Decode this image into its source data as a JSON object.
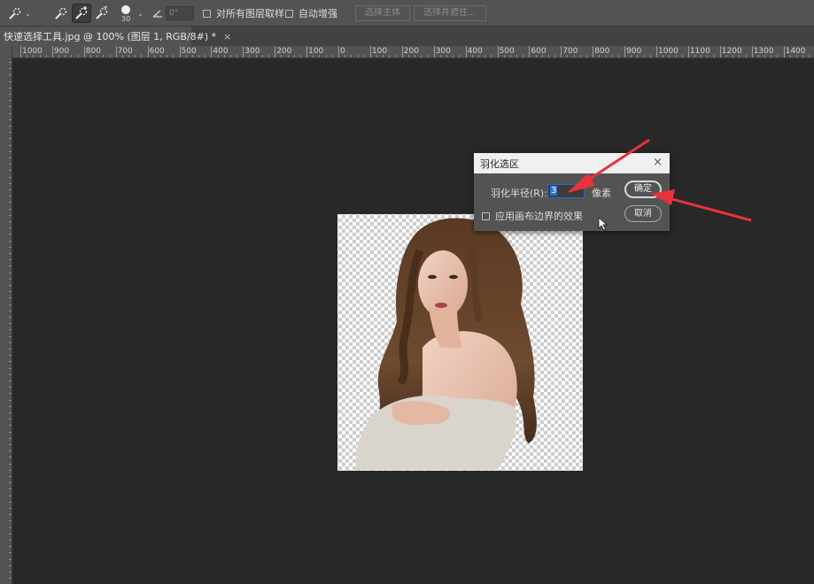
{
  "options_bar": {
    "brush_size": "30",
    "angle_value": "0°",
    "sample_all_layers": "对所有图层取样",
    "auto_enhance": "自动增强",
    "select_subject": "选择主体",
    "select_and_mask": "选择并遮住..."
  },
  "document_tab": {
    "title": "快速选择工具.jpg @ 100% (图层 1, RGB/8#) *",
    "close": "×"
  },
  "ruler": {
    "labels": [
      "1000",
      "900",
      "800",
      "700",
      "600",
      "500",
      "400",
      "300",
      "200",
      "100",
      "0",
      "100",
      "200",
      "300",
      "400",
      "500",
      "600",
      "700",
      "800",
      "900",
      "1000",
      "1100",
      "1200",
      "1300",
      "1400"
    ]
  },
  "dialog": {
    "title": "羽化选区",
    "close": "×",
    "radius_label": "羽化半径(R):",
    "radius_value": "3",
    "unit": "像素",
    "apply_canvas_bounds": "应用画布边界的效果",
    "ok": "确定",
    "cancel": "取消"
  },
  "colors": {
    "workspace": "#282828",
    "panel": "#535353",
    "annotation_arrow": "#e8333a",
    "selection_blue": "#2a73d9"
  }
}
